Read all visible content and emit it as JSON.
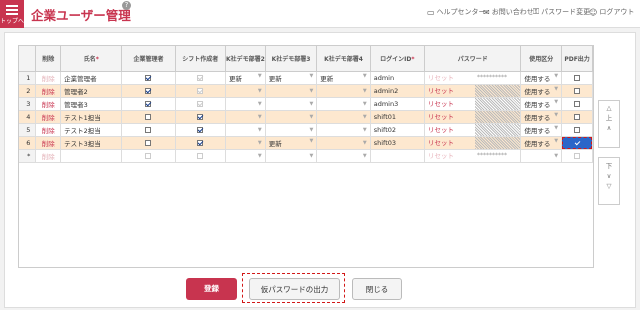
{
  "header": {
    "home_label": "トップへ",
    "title": "企業ユーザー管理",
    "help_mark": "?",
    "nav": [
      {
        "label": "ヘルプセンター",
        "icon": "book-icon"
      },
      {
        "label": "お問い合わせ",
        "icon": "mail-icon"
      },
      {
        "label": "パスワード変更",
        "icon": "key-icon"
      },
      {
        "label": "ログアウト",
        "icon": "user-icon"
      }
    ]
  },
  "table": {
    "columns": [
      "",
      "削除",
      "氏名",
      "企業管理者",
      "シフト作成者",
      "K社デモ部署2",
      "K社デモ部署3",
      "K社デモ部署4",
      "ログインID",
      "パスワード",
      "使用区分",
      "PDF出力"
    ],
    "required_mark": "*",
    "delete_label": "削除",
    "reset_label": "リセット",
    "rows": [
      {
        "no": "1",
        "name": "企業管理者",
        "admin": true,
        "admin_disabled": false,
        "shift": true,
        "shift_disabled": true,
        "dept2": "更新",
        "dept3": "更新",
        "dept4": "更新",
        "login": "admin",
        "password": "**********",
        "usage": "使用する",
        "pdf": false,
        "selected": false,
        "delete_dim": true
      },
      {
        "no": "2",
        "name": "管理者2",
        "admin": true,
        "admin_disabled": false,
        "shift": true,
        "shift_disabled": true,
        "dept2": "",
        "dept3": "",
        "dept4": "",
        "login": "admin2",
        "password": "",
        "usage": "使用する",
        "pdf": false,
        "selected": true,
        "delete_dim": false
      },
      {
        "no": "3",
        "name": "管理者3",
        "admin": true,
        "admin_disabled": false,
        "shift": true,
        "shift_disabled": true,
        "dept2": "",
        "dept3": "",
        "dept4": "",
        "login": "admin3",
        "password": "",
        "usage": "使用する",
        "pdf": false,
        "selected": false,
        "delete_dim": false
      },
      {
        "no": "4",
        "name": "テスト1担当",
        "admin": false,
        "admin_disabled": false,
        "shift": true,
        "shift_disabled": false,
        "dept2": "",
        "dept3": "",
        "dept4": "",
        "login": "shift01",
        "password": "",
        "usage": "使用する",
        "pdf": false,
        "selected": true,
        "delete_dim": false
      },
      {
        "no": "5",
        "name": "テスト2担当",
        "admin": false,
        "admin_disabled": false,
        "shift": true,
        "shift_disabled": false,
        "dept2": "",
        "dept3": "",
        "dept4": "",
        "login": "shift02",
        "password": "",
        "usage": "使用する",
        "pdf": false,
        "selected": false,
        "delete_dim": false
      },
      {
        "no": "6",
        "name": "テスト3担当",
        "admin": false,
        "admin_disabled": false,
        "shift": true,
        "shift_disabled": false,
        "dept2": "",
        "dept3": "更新",
        "dept4": "",
        "login": "shift03",
        "password": "",
        "usage": "使用する",
        "pdf": true,
        "selected": true,
        "delete_dim": false
      },
      {
        "no": "*",
        "name": "",
        "admin": false,
        "admin_disabled": true,
        "shift": false,
        "shift_disabled": true,
        "dept2": "",
        "dept3": "",
        "dept4": "",
        "login": "",
        "password": "**********",
        "usage": "",
        "pdf": false,
        "selected": false,
        "delete_dim": true,
        "new_row": true
      }
    ]
  },
  "side": {
    "up_label": "上",
    "down_label": "下"
  },
  "footer": {
    "register_label": "登録",
    "temp_password_label": "仮パスワードの出力",
    "close_label": "閉じる"
  },
  "colors": {
    "brand": "#c8344f",
    "selected_row": "#fde8cf",
    "focus_cell": "#2a66c9",
    "annotation": "#d21818"
  }
}
